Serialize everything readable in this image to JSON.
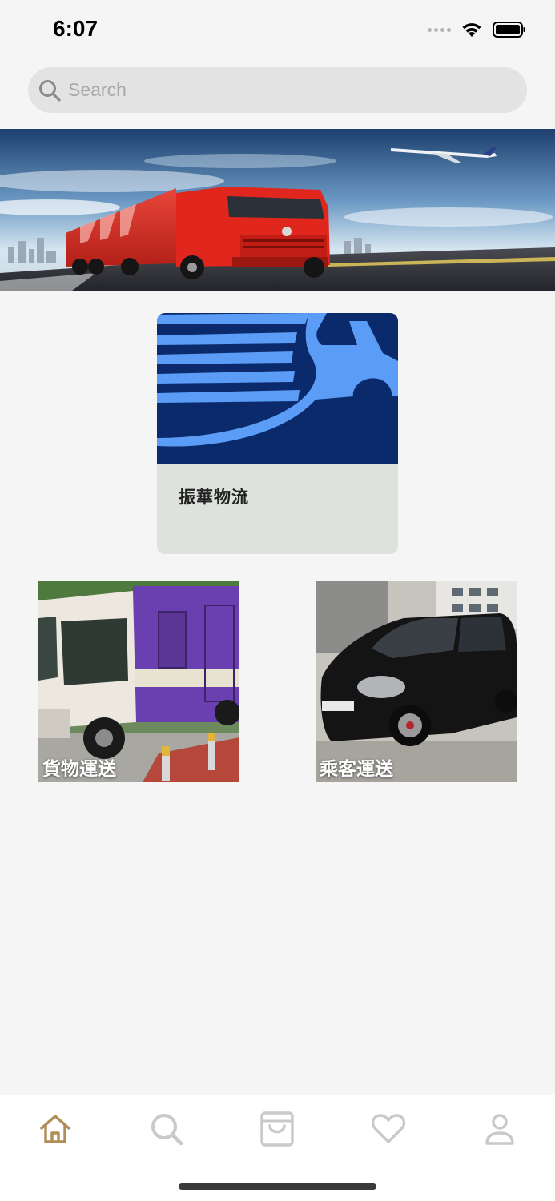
{
  "status_bar": {
    "time": "6:07"
  },
  "search": {
    "placeholder": "Search",
    "value": ""
  },
  "company_card": {
    "name": "振華物流"
  },
  "services": [
    {
      "label": "貨物運送"
    },
    {
      "label": "乘客運送"
    }
  ],
  "tab_bar": {
    "active_tab": "home",
    "tabs": [
      "home-icon",
      "search-icon",
      "shopping-bag-icon",
      "heart-icon",
      "profile-icon"
    ]
  },
  "colors": {
    "background": "#f5f5f5",
    "active_tab": "#b08d57",
    "inactive_tab": "#c9c9c9",
    "logo_navy": "#0b2a6b",
    "logo_blue": "#5b9cf6",
    "card_bottom": "#dee2dd"
  }
}
